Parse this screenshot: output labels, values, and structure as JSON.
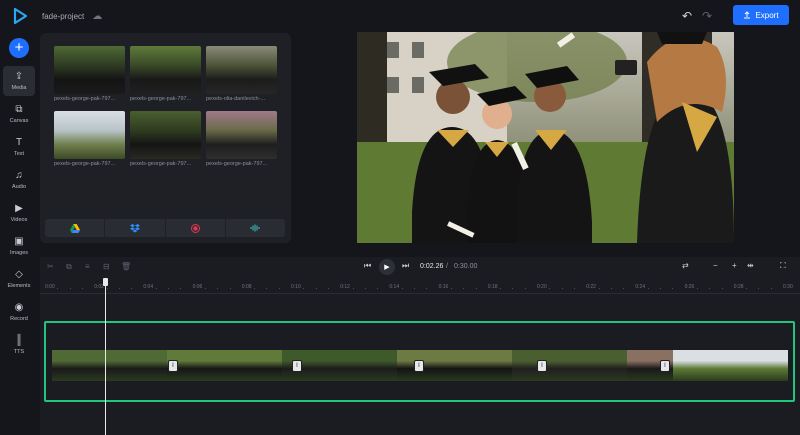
{
  "app": {
    "project_name": "fade-project",
    "export_label": "Export"
  },
  "rail": {
    "items": [
      {
        "label": "Media",
        "icon": "cloud-upload-icon"
      },
      {
        "label": "Canvas",
        "icon": "canvas-icon"
      },
      {
        "label": "Text",
        "icon": "text-icon"
      },
      {
        "label": "Audio",
        "icon": "music-note-icon"
      },
      {
        "label": "Videos",
        "icon": "video-icon"
      },
      {
        "label": "Images",
        "icon": "image-icon"
      },
      {
        "label": "Elements",
        "icon": "shapes-icon"
      },
      {
        "label": "Record",
        "icon": "record-icon"
      },
      {
        "label": "TTS",
        "icon": "soundwave-icon"
      }
    ]
  },
  "media": {
    "thumbnails": [
      {
        "label": "pexels-george-pak-797..."
      },
      {
        "label": "pexels-george-pak-797..."
      },
      {
        "label": "pexels-olia-danilevich-..."
      },
      {
        "label": "pexels-george-pak-797..."
      },
      {
        "label": "pexels-george-pak-797..."
      },
      {
        "label": "pexels-george-pak-797..."
      }
    ],
    "sources": [
      "google-drive-icon",
      "dropbox-icon",
      "record-icon",
      "soundwave-icon"
    ]
  },
  "timeline": {
    "current_time": "0:02.26",
    "separator": "/",
    "total_time": "0:30.00",
    "ticks": [
      "0:00",
      "0:02",
      "0:04",
      "0:06",
      "0:08",
      "0:10",
      "0:12",
      "0:14",
      "0:16",
      "0:18",
      "0:20",
      "0:22",
      "0:24",
      "0:26",
      "0:28",
      "0:30"
    ],
    "transition_label": "I"
  },
  "colors": {
    "accent": "#1e6fff",
    "track_highlight": "#1fc77e",
    "background": "#15161b"
  }
}
